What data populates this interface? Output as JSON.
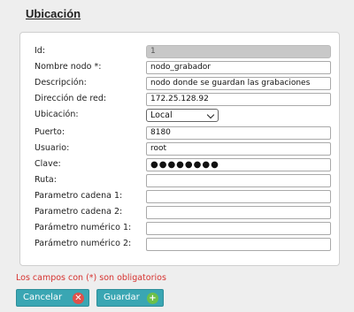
{
  "page": {
    "title": "Ubicación"
  },
  "form": {
    "fields": [
      {
        "label": "Id:",
        "value": "1",
        "type": "readonly"
      },
      {
        "label": "Nombre nodo *:",
        "value": "nodo_grabador",
        "type": "text"
      },
      {
        "label": "Descripción:",
        "value": "nodo donde se guardan las grabaciones",
        "type": "text"
      },
      {
        "label": "Dirección de red:",
        "value": "172.25.128.92",
        "type": "text"
      },
      {
        "label": "Ubicación:",
        "value": "Local",
        "type": "select"
      },
      {
        "label": "Puerto:",
        "value": "8180",
        "type": "text"
      },
      {
        "label": "Usuario:",
        "value": "root",
        "type": "text"
      },
      {
        "label": "Clave:",
        "value": "●●●●●●●●",
        "type": "password"
      },
      {
        "label": "Ruta:",
        "value": "",
        "type": "text"
      },
      {
        "label": "Parametro cadena 1:",
        "value": "",
        "type": "text"
      },
      {
        "label": "Parametro cadena 2:",
        "value": "",
        "type": "text"
      },
      {
        "label": "Parámetro numérico 1:",
        "value": "",
        "type": "text"
      },
      {
        "label": "Parámetro numérico 2:",
        "value": "",
        "type": "text"
      }
    ],
    "required_note": "Los campos con (*) son obligatorios"
  },
  "buttons": {
    "cancel_label": "Cancelar",
    "cancel_icon": "✕",
    "save_label": "Guardar",
    "save_icon": "+"
  },
  "colors": {
    "button_bg": "#3aa6b3",
    "cancel_icon": "#e0504a",
    "save_icon": "#6cc04a",
    "required_note": "#d6322f"
  }
}
